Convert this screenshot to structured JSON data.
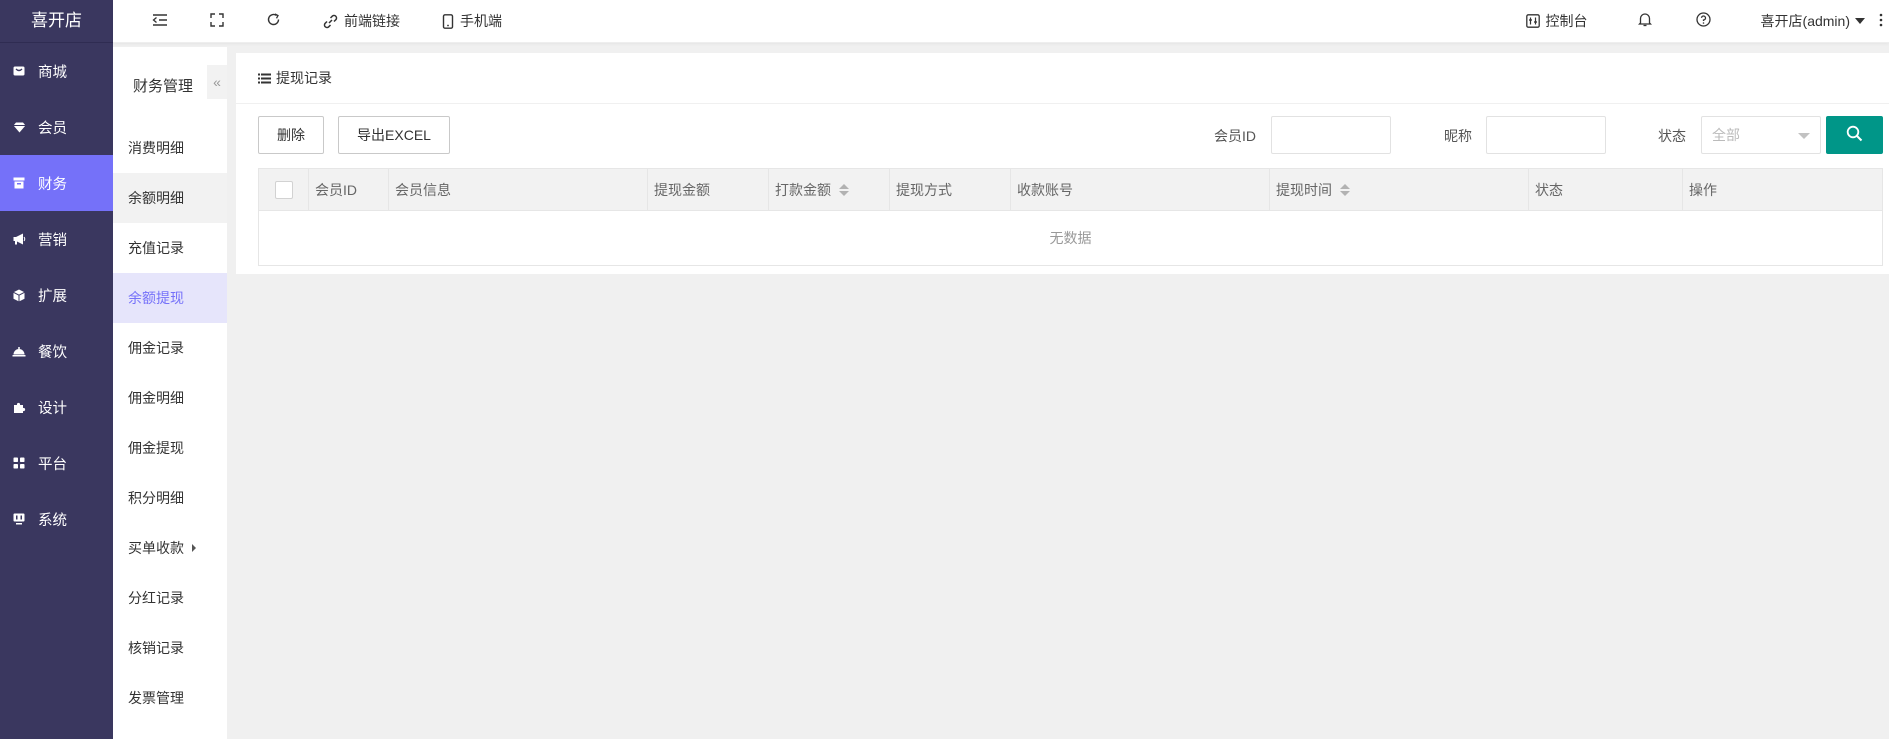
{
  "app": {
    "logo": "喜开店"
  },
  "sidebar": {
    "items": [
      {
        "label": "商城",
        "icon": "shop-icon"
      },
      {
        "label": "会员",
        "icon": "gem-icon"
      },
      {
        "label": "财务",
        "icon": "finance-icon",
        "active": true
      },
      {
        "label": "营销",
        "icon": "megaphone-icon"
      },
      {
        "label": "扩展",
        "icon": "cube-icon"
      },
      {
        "label": "餐饮",
        "icon": "dining-icon"
      },
      {
        "label": "设计",
        "icon": "puzzle-icon"
      },
      {
        "label": "平台",
        "icon": "grid-icon"
      },
      {
        "label": "系统",
        "icon": "monitor-icon"
      }
    ],
    "active_color": "#7571f9",
    "bg_color": "#3a375f"
  },
  "submenu": {
    "title": "财务管理",
    "collapse_label": "«",
    "items": [
      {
        "label": "消费明细"
      },
      {
        "label": "余额明细"
      },
      {
        "label": "充值记录"
      },
      {
        "label": "余额提现"
      },
      {
        "label": "佣金记录"
      },
      {
        "label": "佣金明细"
      },
      {
        "label": "佣金提现"
      },
      {
        "label": "积分明细"
      },
      {
        "label": "买单收款"
      },
      {
        "label": "分红记录"
      },
      {
        "label": "核销记录"
      },
      {
        "label": "发票管理"
      }
    ]
  },
  "topbar": {
    "frontend_link": "前端链接",
    "mobile": "手机端",
    "console": "控制台",
    "user": "喜开店(admin)"
  },
  "panel": {
    "title": "提现记录",
    "delete_label": "删除",
    "export_label": "导出EXCEL",
    "filter_member_id_label": "会员ID",
    "filter_nickname_label": "昵称",
    "filter_status_label": "状态",
    "filter_status_value": "全部",
    "search_color": "#009688"
  },
  "table": {
    "columns": [
      "会员ID",
      "会员信息",
      "提现金额",
      "打款金额",
      "提现方式",
      "收款账号",
      "提现时间",
      "状态",
      "操作"
    ],
    "empty_text": "无数据"
  }
}
